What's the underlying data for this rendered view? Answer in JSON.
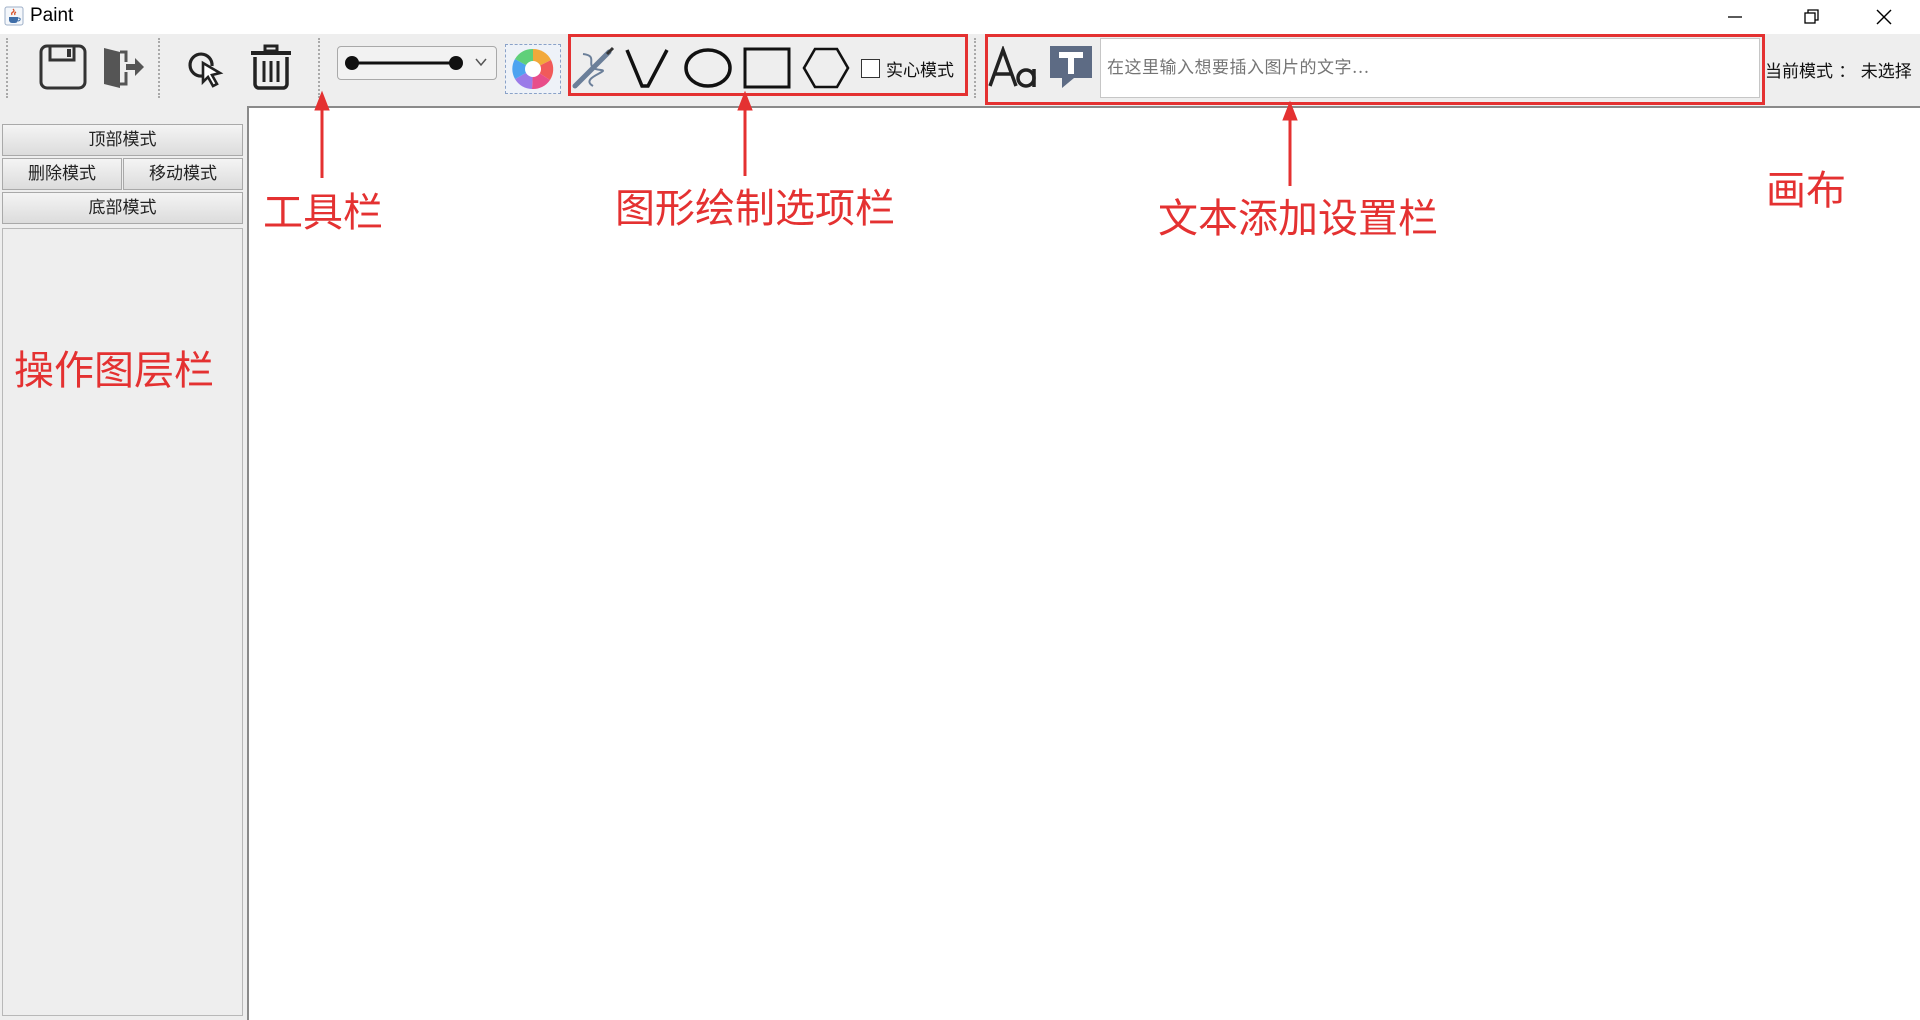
{
  "window": {
    "title": "Paint",
    "icon": "java-cup-icon",
    "controls": [
      "minimize-icon",
      "maximize-icon",
      "close-icon"
    ]
  },
  "toolbar": {
    "buttons": [
      "save-icon",
      "exit-icon",
      "select-cursor-icon",
      "trash-icon"
    ],
    "line_style_icon": "line-with-endpoints-icon",
    "color_picker_icon": "color-wheel-icon",
    "shapes": [
      "freehand-pen-icon",
      "polyline-v-icon",
      "ellipse-icon",
      "rectangle-icon",
      "hexagon-icon"
    ],
    "solid_mode_label": "实心模式",
    "solid_mode_checked": false,
    "font_icon": "font-aa-icon",
    "text_tool_icon": "text-t-icon",
    "text_placeholder": "在这里输入想要插入图片的文字...",
    "mode_label": "当前模式 ： 未选择"
  },
  "layers": {
    "top_mode": "顶部模式",
    "delete_mode": "删除模式",
    "move_mode": "移动模式",
    "bottom_mode": "底部模式"
  },
  "annotations": {
    "toolbar": "工具栏",
    "shape_options": "图形绘制选项栏",
    "text_settings": "文本添加设置栏",
    "canvas": "画布",
    "layer_panel": "操作图层栏",
    "color": "#e43131"
  }
}
